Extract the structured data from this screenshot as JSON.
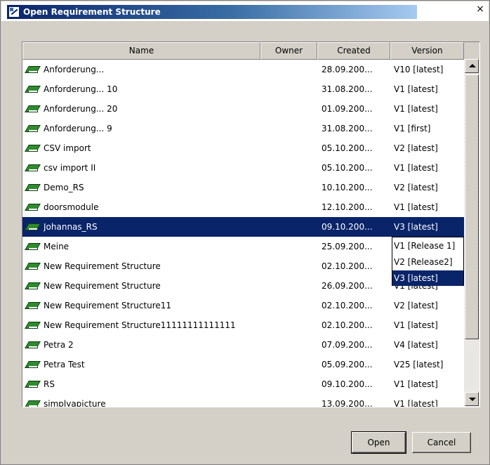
{
  "window": {
    "title": "Open Requirement Structure",
    "close_glyph": "×"
  },
  "table": {
    "columns": [
      "Name",
      "Owner",
      "Created",
      "Version"
    ],
    "rows": [
      {
        "name": "Anforderung...",
        "owner": "",
        "created": "28.09.200...",
        "version": "V10 [latest]"
      },
      {
        "name": "Anforderung... 10",
        "owner": "",
        "created": "31.08.200...",
        "version": "V1 [latest]"
      },
      {
        "name": "Anforderung... 20",
        "owner": "",
        "created": "01.09.200...",
        "version": "V1 [latest]"
      },
      {
        "name": "Anforderung... 9",
        "owner": "",
        "created": "31.08.200...",
        "version": "V1 [first]"
      },
      {
        "name": "CSV import",
        "owner": "",
        "created": "05.10.200...",
        "version": "V2 [latest]"
      },
      {
        "name": "csv import II",
        "owner": "",
        "created": "05.10.200...",
        "version": "V1 [latest]"
      },
      {
        "name": "Demo_RS",
        "owner": "",
        "created": "10.10.200...",
        "version": "V2 [latest]"
      },
      {
        "name": "doorsmodule",
        "owner": "",
        "created": "12.10.200...",
        "version": "V1 [latest]"
      },
      {
        "name": "Johannas_RS",
        "owner": "",
        "created": "09.10.200...",
        "version": "V3 [latest]",
        "selected": true
      },
      {
        "name": "Meine",
        "owner": "",
        "created": "25.09.200...",
        "version": ""
      },
      {
        "name": "New Requirement Structure",
        "owner": "",
        "created": "02.10.200...",
        "version": ""
      },
      {
        "name": "New Requirement Structure",
        "owner": "",
        "created": "26.09.200...",
        "version": "V1 [latest]"
      },
      {
        "name": "New Requirement Structure11",
        "owner": "",
        "created": "02.10.200...",
        "version": "V2 [latest]"
      },
      {
        "name": "New Requirement Structure11111111111111",
        "owner": "",
        "created": "02.10.200...",
        "version": "V1 [latest]"
      },
      {
        "name": "Petra 2",
        "owner": "",
        "created": "07.09.200...",
        "version": "V4 [latest]"
      },
      {
        "name": "Petra Test",
        "owner": "",
        "created": "05.09.200...",
        "version": "V25 [latest]"
      },
      {
        "name": "RS",
        "owner": "",
        "created": "09.10.200...",
        "version": "V1 [latest]"
      },
      {
        "name": "simplyapicture",
        "owner": "",
        "created": "13.09.200...",
        "version": "V1 [latest]"
      }
    ]
  },
  "version_dropdown": {
    "options": [
      "V1 [Release 1]",
      "V2 [Release2]",
      "V3 [latest]"
    ],
    "selected": "V3 [latest]"
  },
  "buttons": {
    "open": "Open",
    "cancel": "Cancel"
  },
  "colors": {
    "selection": "#0a246a",
    "dialog_bg": "#d4d0c8",
    "book_icon": "#2e8b2e"
  },
  "icons": {
    "title": "requirement-structure-icon",
    "row": "green-book-icon"
  }
}
